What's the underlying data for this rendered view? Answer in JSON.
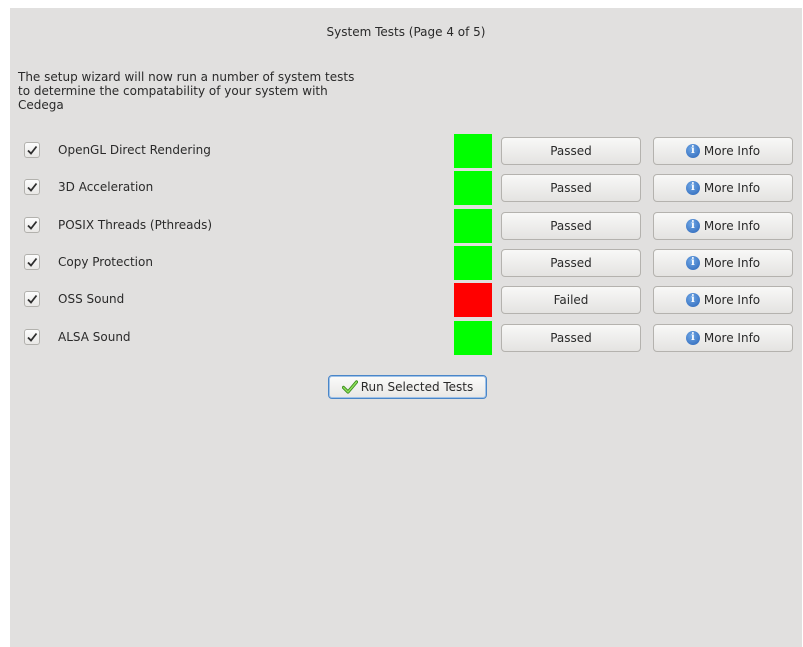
{
  "title": "System Tests (Page 4 of 5)",
  "intro": [
    "The setup wizard will now run a number of system tests",
    "to determine the compatability of your system with",
    "Cedega"
  ],
  "colors": {
    "passed": "#00ff00",
    "failed": "#ff0000"
  },
  "tests": [
    {
      "label": "OpenGL Direct Rendering",
      "status": "Passed",
      "result": "passed",
      "checked": true,
      "more": "More Info"
    },
    {
      "label": "3D Acceleration",
      "status": "Passed",
      "result": "passed",
      "checked": true,
      "more": "More Info"
    },
    {
      "label": "POSIX Threads (Pthreads)",
      "status": "Passed",
      "result": "passed",
      "checked": true,
      "more": "More Info"
    },
    {
      "label": "Copy Protection",
      "status": "Passed",
      "result": "passed",
      "checked": true,
      "more": "More Info"
    },
    {
      "label": "OSS Sound",
      "status": "Failed",
      "result": "failed",
      "checked": true,
      "more": "More Info"
    },
    {
      "label": "ALSA Sound",
      "status": "Passed",
      "result": "passed",
      "checked": true,
      "more": "More Info"
    }
  ],
  "run_button": {
    "label": "Run Selected Tests",
    "icon": "checkmark-icon"
  },
  "icons": {
    "info": "info-icon",
    "checkbox": "checkmark-icon"
  }
}
